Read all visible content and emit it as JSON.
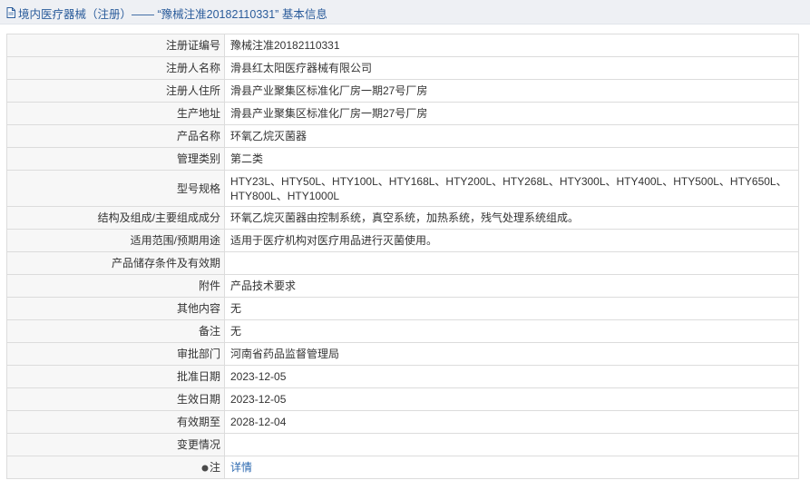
{
  "header": {
    "icon": "document-icon",
    "title": "境内医疗器械（注册）—— “豫械注准20182110331” 基本信息"
  },
  "rows": [
    {
      "label": "注册证编号",
      "value": "豫械注准20182110331"
    },
    {
      "label": "注册人名称",
      "value": "滑县红太阳医疗器械有限公司"
    },
    {
      "label": "注册人住所",
      "value": "滑县产业聚集区标准化厂房一期27号厂房"
    },
    {
      "label": "生产地址",
      "value": "滑县产业聚集区标准化厂房一期27号厂房"
    },
    {
      "label": "产品名称",
      "value": "环氧乙烷灭菌器"
    },
    {
      "label": "管理类别",
      "value": "第二类"
    },
    {
      "label": "型号规格",
      "value": "HTY23L、HTY50L、HTY100L、HTY168L、HTY200L、HTY268L、HTY300L、HTY400L、HTY500L、HTY650L、HTY800L、HTY1000L"
    },
    {
      "label": "结构及组成/主要组成成分",
      "value": "环氧乙烷灭菌器由控制系统，真空系统，加热系统，残气处理系统组成。"
    },
    {
      "label": "适用范围/预期用途",
      "value": "适用于医疗机构对医疗用品进行灭菌使用。"
    },
    {
      "label": "产品储存条件及有效期",
      "value": ""
    },
    {
      "label": "附件",
      "value": "产品技术要求"
    },
    {
      "label": "其他内容",
      "value": "无"
    },
    {
      "label": "备注",
      "value": "无"
    },
    {
      "label": "审批部门",
      "value": "河南省药品监督管理局"
    },
    {
      "label": "批准日期",
      "value": "2023-12-05"
    },
    {
      "label": "生效日期",
      "value": "2023-12-05"
    },
    {
      "label": "有效期至",
      "value": "2028-12-04"
    },
    {
      "label": "变更情况",
      "value": ""
    }
  ],
  "note_row": {
    "label": "注",
    "icon": "pin-icon",
    "link_text": "详情"
  },
  "colors": {
    "header_bg": "#eef0f4",
    "header_text": "#2b5c9b",
    "label_bg": "#f7f7f7",
    "border": "#dcdcdc",
    "link": "#2b68b0"
  }
}
